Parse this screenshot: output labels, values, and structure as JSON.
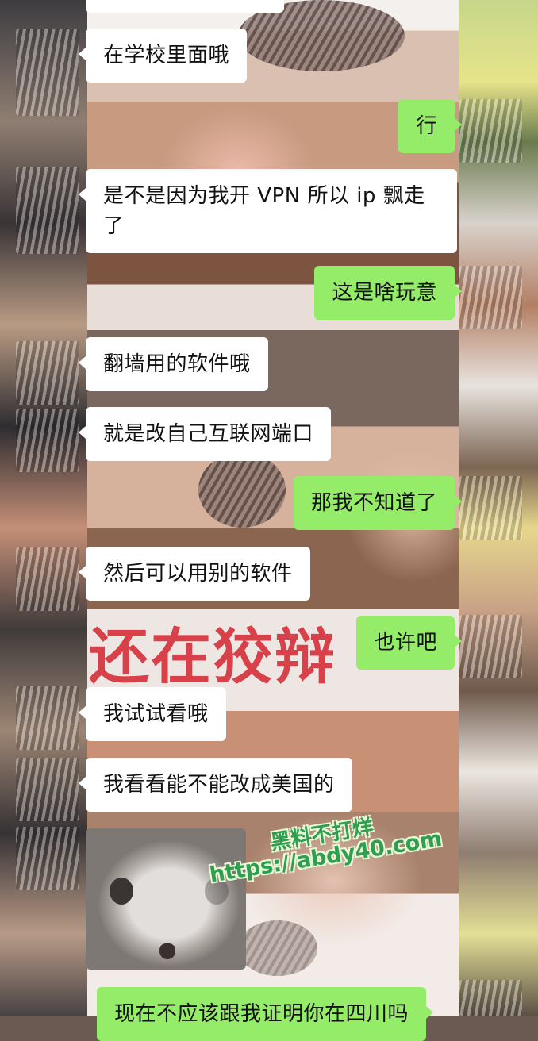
{
  "chat": {
    "messages": [
      {
        "side": "in",
        "text": "在学校里面哦"
      },
      {
        "side": "out",
        "text": "行"
      },
      {
        "side": "in",
        "text": "是不是因为我开 VPN 所以 ip 飘走了"
      },
      {
        "side": "out",
        "text": "这是啥玩意"
      },
      {
        "side": "in",
        "text": "翻墙用的软件哦"
      },
      {
        "side": "in",
        "text": "就是改自己互联网端口"
      },
      {
        "side": "out",
        "text": "那我不知道了"
      },
      {
        "side": "in",
        "text": "然后可以用别的软件"
      },
      {
        "side": "out",
        "text": "也许吧"
      },
      {
        "side": "in",
        "text": "我试试看哦"
      },
      {
        "side": "in",
        "text": "我看看能不能改成美国的"
      },
      {
        "side": "in",
        "text": "[sticker]"
      },
      {
        "side": "out",
        "text": "现在不应该跟我证明你在四川吗"
      }
    ]
  },
  "overlay": {
    "caption": "还在狡辩"
  },
  "watermark": {
    "line1": "黑料不打烊",
    "line2": "https://abdy40.com"
  },
  "colors": {
    "outgoing_bubble": "#95ec69",
    "incoming_bubble": "#ffffff",
    "caption": "#d8404a",
    "watermark": "#2e9e4f"
  }
}
